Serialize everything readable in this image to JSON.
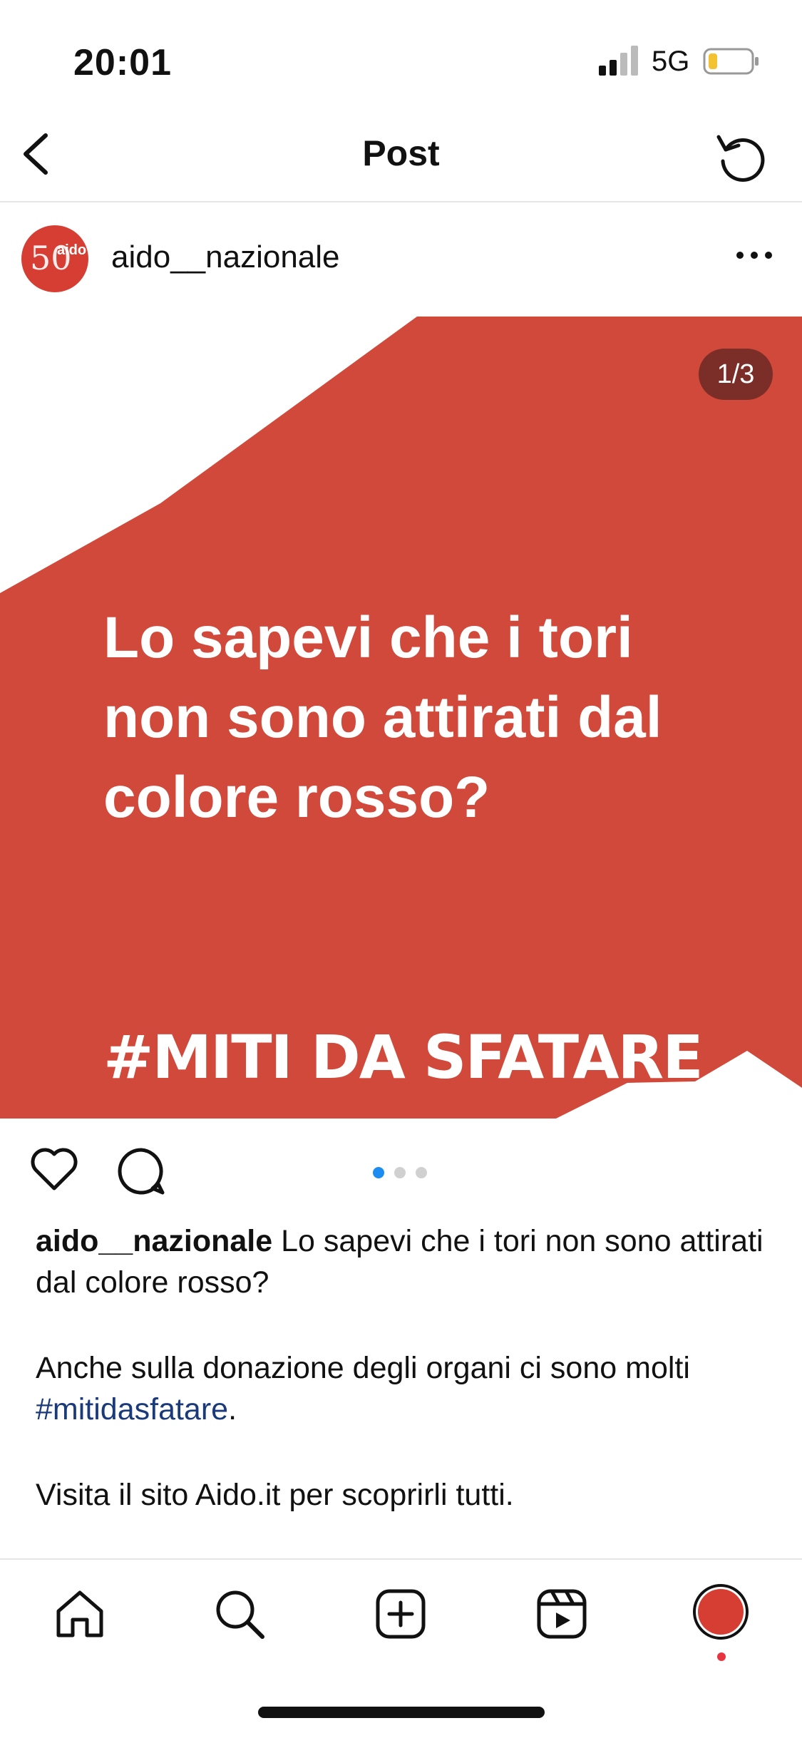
{
  "status_bar": {
    "time": "20:01",
    "network": "5G"
  },
  "nav": {
    "title": "Post"
  },
  "post": {
    "username": "aido__nazionale",
    "avatar_text": "aido",
    "counter": "1/3",
    "image_text": "Lo sapevi che i tori non sono attirati dal colore rosso?",
    "image_hashtag": "#MITI DA SFATARE",
    "carousel_dots": 3,
    "carousel_active": 0
  },
  "caption": {
    "username": "aido__nazionale",
    "line1": " Lo sapevi che i tori non sono attirati dal colore rosso?",
    "line2_prefix": "Anche sulla donazione degli organi ci sono molti ",
    "hashtag": "#mitidasfatare",
    "line2_suffix": ".",
    "line3": "Visita il sito Aido.it per scoprirli tutti."
  },
  "colors": {
    "brand_red": "#d1493a",
    "link": "#1a3a7a",
    "active_dot": "#1d8cf0"
  },
  "tabbar": [
    "home-icon",
    "search-icon",
    "create-icon",
    "reels-icon",
    "profile-avatar"
  ]
}
